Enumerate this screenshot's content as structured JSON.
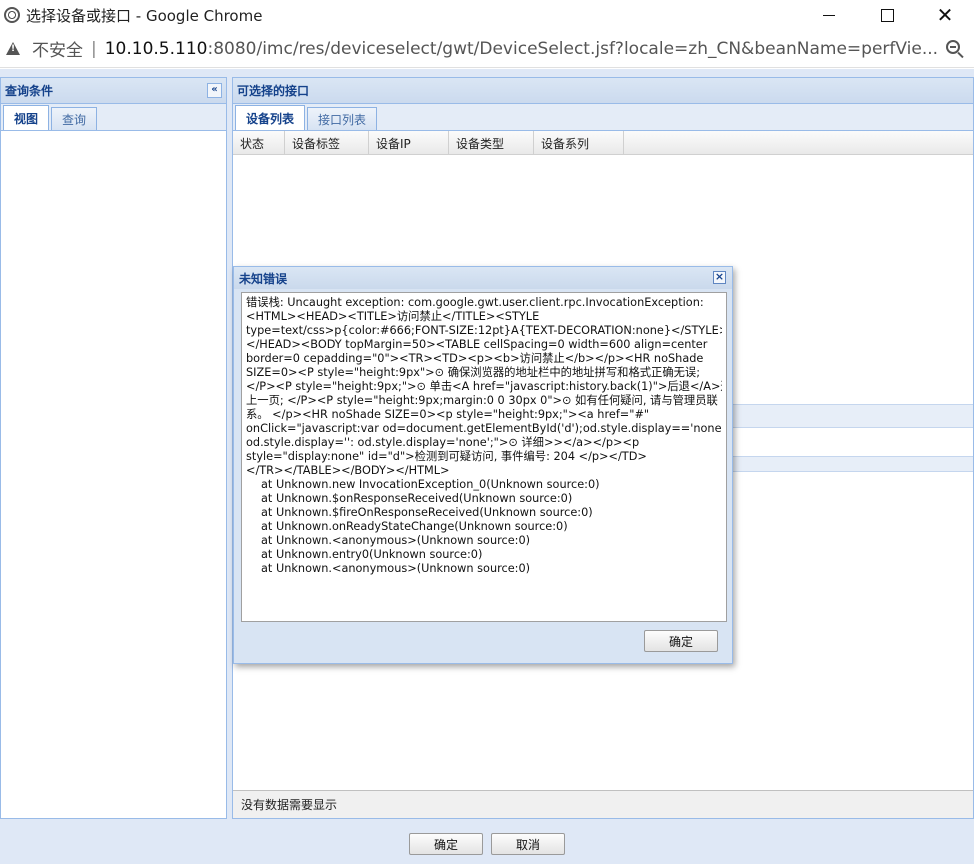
{
  "window": {
    "title": "选择设备或接口 - Google Chrome"
  },
  "address": {
    "security": "不安全",
    "separator": "|",
    "host": "10.10.5.110",
    "rest": ":8080/imc/res/deviceselect/gwt/DeviceSelect.jsf?locale=zh_CN&beanName=perfVie..."
  },
  "left_panel": {
    "title": "查询条件",
    "collapse_glyph": "«",
    "tabs": [
      "视图",
      "查询"
    ]
  },
  "right_panel": {
    "title": "可选择的接口",
    "tabs": [
      "设备列表",
      "接口列表"
    ],
    "columns": [
      "状态",
      "设备标签",
      "设备IP",
      "设备类型",
      "设备系列"
    ],
    "status_text": "没有数据需要显示"
  },
  "footer": {
    "ok_label": "确定",
    "cancel_label": "取消"
  },
  "dialog": {
    "title": "未知错误",
    "close_glyph": "×",
    "ok_label": "确定",
    "message_lines": [
      "错误栈: Uncaught exception: com.google.gwt.user.client.rpc.InvocationException:",
      "<HTML><HEAD><TITLE>访问禁止</TITLE><STYLE",
      "type=text/css>p{color:#666;FONT-SIZE:12pt}A{TEXT-DECORATION:none}</STYLE>",
      "</HEAD><BODY topMargin=50><TABLE cellSpacing=0 width=600 align=center",
      "border=0 cepadding=\"0\"><TR><TD><p><b>访问禁止</b></p><HR noShade",
      "SIZE=0><P style=\"height:9px\">⊙ 确保浏览器的地址栏中的地址拼写和格式正确无误;",
      "</P><P style=\"height:9px;\">⊙ 单击<A href=\"javascript:history.back(1)\">后退</A>返回",
      "上一页; </P><P style=\"height:9px;margin:0 0 30px 0\">⊙ 如有任何疑问, 请与管理员联",
      "系。 </p><HR noShade SIZE=0><p style=\"height:9px;\"><a href=\"#\"",
      "onClick=\"javascript:var od=document.getElementById('d');od.style.display=='none'?",
      "od.style.display='': od.style.display='none';\">⊙ 详细>></a></p><p",
      "style=\"display:none\" id=\"d\">检测到可疑访问, 事件编号: 204              </p></TD>",
      "</TR></TABLE></BODY></HTML>"
    ],
    "stack_lines": [
      "at Unknown.new InvocationException_0(Unknown source:0)",
      "at Unknown.$onResponseReceived(Unknown source:0)",
      "at Unknown.$fireOnResponseReceived(Unknown source:0)",
      "at Unknown.onReadyStateChange(Unknown source:0)",
      "at Unknown.<anonymous>(Unknown source:0)",
      "at Unknown.entry0(Unknown source:0)",
      "at Unknown.<anonymous>(Unknown source:0)"
    ]
  }
}
